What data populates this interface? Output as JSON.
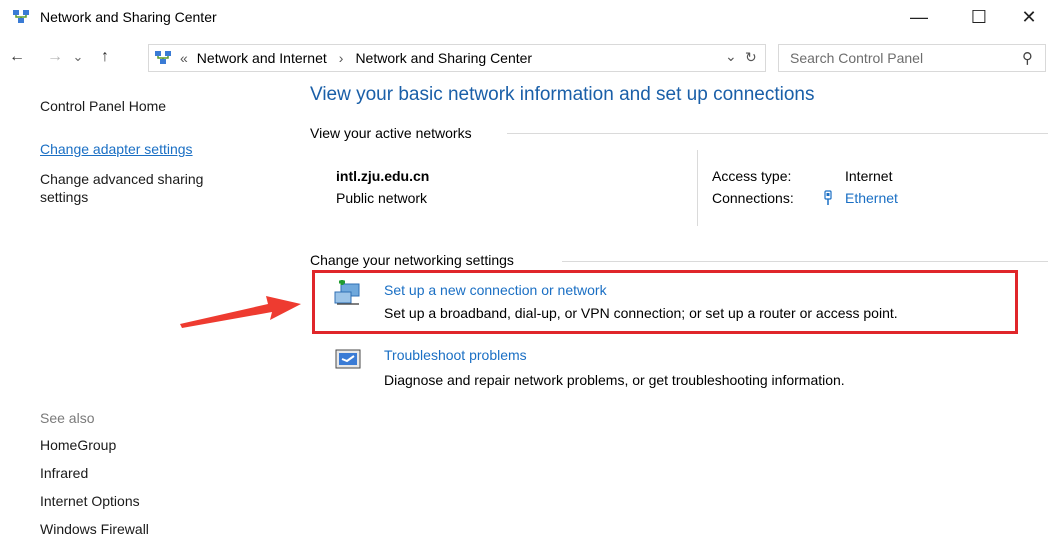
{
  "window": {
    "title": "Network and Sharing Center",
    "minimize_glyph": "—",
    "maximize_glyph": "☐",
    "close_glyph": "✕"
  },
  "nav": {
    "back_glyph": "←",
    "forward_glyph": "→",
    "recent_glyph": "⌄",
    "up_glyph": "↑",
    "breadcrumb_overflow": "«",
    "breadcrumb": [
      "Network and Internet",
      "Network and Sharing Center"
    ],
    "separator": "›",
    "dropdown_glyph": "⌄",
    "refresh_glyph": "↻",
    "search_placeholder": "Search Control Panel",
    "search_icon_glyph": "⚲"
  },
  "sidebar": {
    "home": "Control Panel Home",
    "links": [
      "Change adapter settings",
      "Change advanced sharing settings"
    ],
    "see_also_label": "See also",
    "see_also": [
      "HomeGroup",
      "Infrared",
      "Internet Options",
      "Windows Firewall"
    ]
  },
  "main": {
    "heading": "View your basic network information and set up connections",
    "active_networks_label": "View your active networks",
    "network": {
      "name": "intl.zju.edu.cn",
      "type": "Public network",
      "access_type_label": "Access type:",
      "access_type_value": "Internet",
      "connections_label": "Connections:",
      "connections_value": "Ethernet"
    },
    "change_settings_label": "Change your networking settings",
    "tasks": [
      {
        "title": "Set up a new connection or network",
        "description": "Set up a broadband, dial-up, or VPN connection; or set up a router or access point."
      },
      {
        "title": "Troubleshoot problems",
        "description": "Diagnose and repair network problems, or get troubleshooting information."
      }
    ]
  },
  "colors": {
    "link": "#1a6fc4",
    "heading": "#1a5fa8",
    "highlight_box": "#e0262a",
    "arrow": "#ee3b30"
  }
}
